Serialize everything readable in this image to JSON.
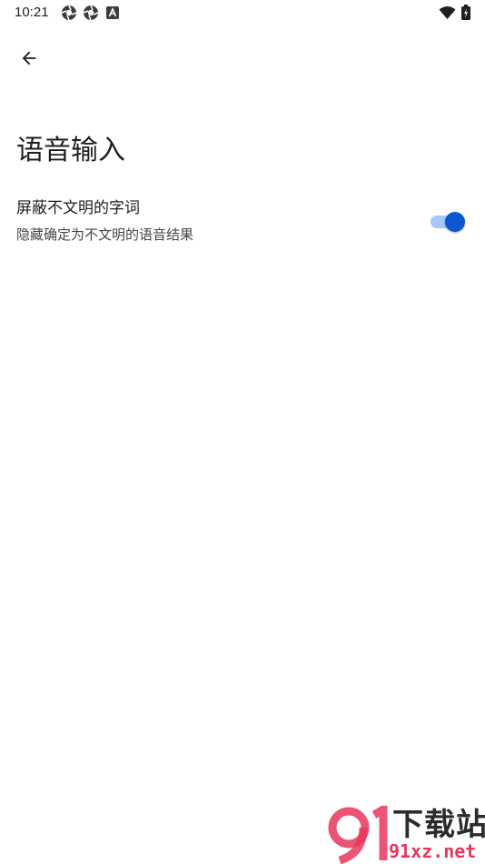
{
  "status_bar": {
    "time": "10:21",
    "icons_left": [
      "aperture-icon",
      "aperture-icon",
      "font-a-icon"
    ],
    "icons_right": [
      "wifi-icon",
      "battery-charging-icon"
    ]
  },
  "app_bar": {
    "back_icon": "arrow-back-icon"
  },
  "page": {
    "title": "语音输入"
  },
  "settings": [
    {
      "title": "屏蔽不文明的字词",
      "summary": "隐藏确定为不文明的语音结果",
      "enabled": true
    }
  ],
  "watermark": {
    "brand": "下载站",
    "domain": "91xz.net"
  },
  "colors": {
    "accent": "#0b57d0",
    "track_on": "#a8c7fa",
    "watermark_red": "#e8365c"
  }
}
